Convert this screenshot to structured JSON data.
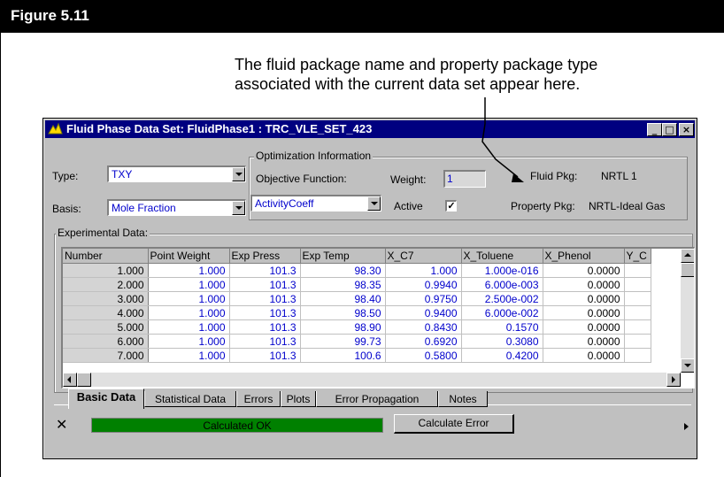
{
  "figure": {
    "title": "Figure 5.11",
    "annotation_line1": "The fluid package name and property package type",
    "annotation_line2": "associated with the current data set appear here."
  },
  "window": {
    "title": "Fluid Phase Data Set: FluidPhase1 : TRC_VLE_SET_423",
    "min_glyph": "_",
    "max_glyph": "□",
    "close_glyph": "×"
  },
  "form": {
    "type_label": "Type:",
    "type_value": "TXY",
    "basis_label": "Basis:",
    "basis_value": "Mole Fraction",
    "opt_group_title": "Optimization Information",
    "objective_label": "Objective Function:",
    "objective_value": "ActivityCoeff",
    "weight_label": "Weight:",
    "weight_value": "1",
    "active_label": "Active",
    "active_checked": "✓",
    "fluid_pkg_label": "Fluid Pkg:",
    "fluid_pkg_value": "NRTL 1",
    "property_pkg_label": "Property Pkg:",
    "property_pkg_value": "NRTL-Ideal Gas"
  },
  "experimental": {
    "group_title": "Experimental Data:",
    "columns": [
      "Number",
      "Point Weight",
      "Exp Press",
      "Exp Temp",
      "X_C7",
      "X_Toluene",
      "X_Phenol",
      "Y_C"
    ],
    "rows": [
      [
        "1.000",
        "1.000",
        "101.3",
        "98.30",
        "1.000",
        "1.000e-016",
        "0.0000"
      ],
      [
        "2.000",
        "1.000",
        "101.3",
        "98.35",
        "0.9940",
        "6.000e-003",
        "0.0000"
      ],
      [
        "3.000",
        "1.000",
        "101.3",
        "98.40",
        "0.9750",
        "2.500e-002",
        "0.0000"
      ],
      [
        "4.000",
        "1.000",
        "101.3",
        "98.50",
        "0.9400",
        "6.000e-002",
        "0.0000"
      ],
      [
        "5.000",
        "1.000",
        "101.3",
        "98.90",
        "0.8430",
        "0.1570",
        "0.0000"
      ],
      [
        "6.000",
        "1.000",
        "101.3",
        "99.73",
        "0.6920",
        "0.3080",
        "0.0000"
      ],
      [
        "7.000",
        "1.000",
        "101.3",
        "100.6",
        "0.5800",
        "0.4200",
        "0.0000"
      ]
    ]
  },
  "tabs": [
    "Basic Data",
    "Statistical Data",
    "Errors",
    "Plots",
    "Error Propagation",
    "Notes"
  ],
  "footer": {
    "x_glyph": "✕",
    "status_text": "Calculated OK",
    "status_color": "#008000",
    "calc_button": "Calculate Error"
  }
}
